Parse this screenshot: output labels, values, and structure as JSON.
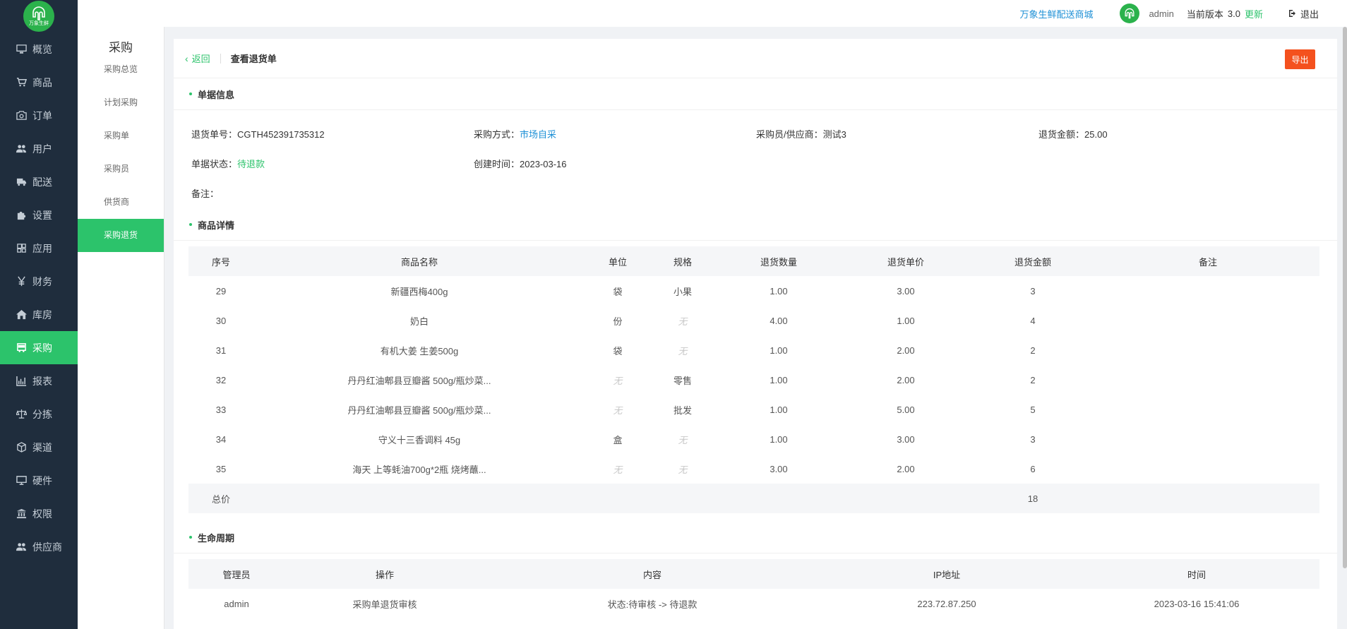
{
  "brand": {
    "logo_text": "万象生鲜",
    "color": "#2bb24c"
  },
  "nav": {
    "items": [
      {
        "label": "概览",
        "icon": "monitor-icon"
      },
      {
        "label": "商品",
        "icon": "cart-icon"
      },
      {
        "label": "订单",
        "icon": "camera-icon"
      },
      {
        "label": "用户",
        "icon": "users-icon"
      },
      {
        "label": "配送",
        "icon": "truck-icon"
      },
      {
        "label": "设置",
        "icon": "puzzle-icon"
      },
      {
        "label": "应用",
        "icon": "app-icon"
      },
      {
        "label": "财务",
        "icon": "yen-icon"
      },
      {
        "label": "库房",
        "icon": "home-icon"
      },
      {
        "label": "采购",
        "icon": "bus-icon"
      },
      {
        "label": "报表",
        "icon": "bar-chart-icon"
      },
      {
        "label": "分拣",
        "icon": "scale-icon"
      },
      {
        "label": "渠道",
        "icon": "cube-icon"
      },
      {
        "label": "硬件",
        "icon": "desktop-icon"
      },
      {
        "label": "权限",
        "icon": "bank-icon"
      },
      {
        "label": "供应商",
        "icon": "users-icon"
      }
    ],
    "active_index": 9
  },
  "subnav": {
    "title": "采购",
    "items": [
      "采购总览",
      "计划采购",
      "采购单",
      "采购员",
      "供货商",
      "采购退货"
    ],
    "active_index": 5
  },
  "topbar": {
    "shop_link": "万象生鲜配送商城",
    "user": "admin",
    "version_label": "当前版本",
    "version": "3.0",
    "update": "更新",
    "logout": "退出"
  },
  "header": {
    "back": "返回",
    "title": "查看退货单",
    "export": "导出"
  },
  "info": {
    "section_title": "单据信息",
    "order_no_label": "退货单号：",
    "order_no": "CGTH452391735312",
    "method_label": "采购方式：",
    "method": "市场自采",
    "buyer_label": "采购员/供应商：",
    "buyer": "测试3",
    "amount_label": "退货金额：",
    "amount": "25.00",
    "status_label": "单据状态：",
    "status": "待退款",
    "created_label": "创建时间：",
    "created": "2023-03-16",
    "remark_label": "备注："
  },
  "goods": {
    "section_title": "商品详情",
    "columns": [
      "序号",
      "商品名称",
      "单位",
      "规格",
      "退货数量",
      "退货单价",
      "退货金额",
      "备注"
    ],
    "rows": [
      [
        "29",
        "新疆西梅400g",
        "袋",
        "小果",
        "1.00",
        "3.00",
        "3",
        ""
      ],
      [
        "30",
        "奶白",
        "份",
        "无",
        "4.00",
        "1.00",
        "4",
        ""
      ],
      [
        "31",
        "有机大姜 生姜500g",
        "袋",
        "无",
        "1.00",
        "2.00",
        "2",
        ""
      ],
      [
        "32",
        "丹丹红油郫县豆瓣酱 500g/瓶炒菜...",
        "无",
        "零售",
        "1.00",
        "2.00",
        "2",
        ""
      ],
      [
        "33",
        "丹丹红油郫县豆瓣酱 500g/瓶炒菜...",
        "无",
        "批发",
        "1.00",
        "5.00",
        "5",
        ""
      ],
      [
        "34",
        "守义十三香调料 45g",
        "盒",
        "无",
        "1.00",
        "3.00",
        "3",
        ""
      ],
      [
        "35",
        "海天 上等蚝油700g*2瓶 烧烤蘸...",
        "无",
        "无",
        "3.00",
        "2.00",
        "6",
        ""
      ]
    ],
    "total_label": "总价",
    "total": "18"
  },
  "lifecycle": {
    "section_title": "生命周期",
    "columns": [
      "管理员",
      "操作",
      "内容",
      "IP地址",
      "时间"
    ],
    "rows": [
      [
        "admin",
        "采购单退货审核",
        "状态:待审核 -> 待退款",
        "223.72.87.250",
        "2023-03-16 15:41:06"
      ]
    ]
  }
}
